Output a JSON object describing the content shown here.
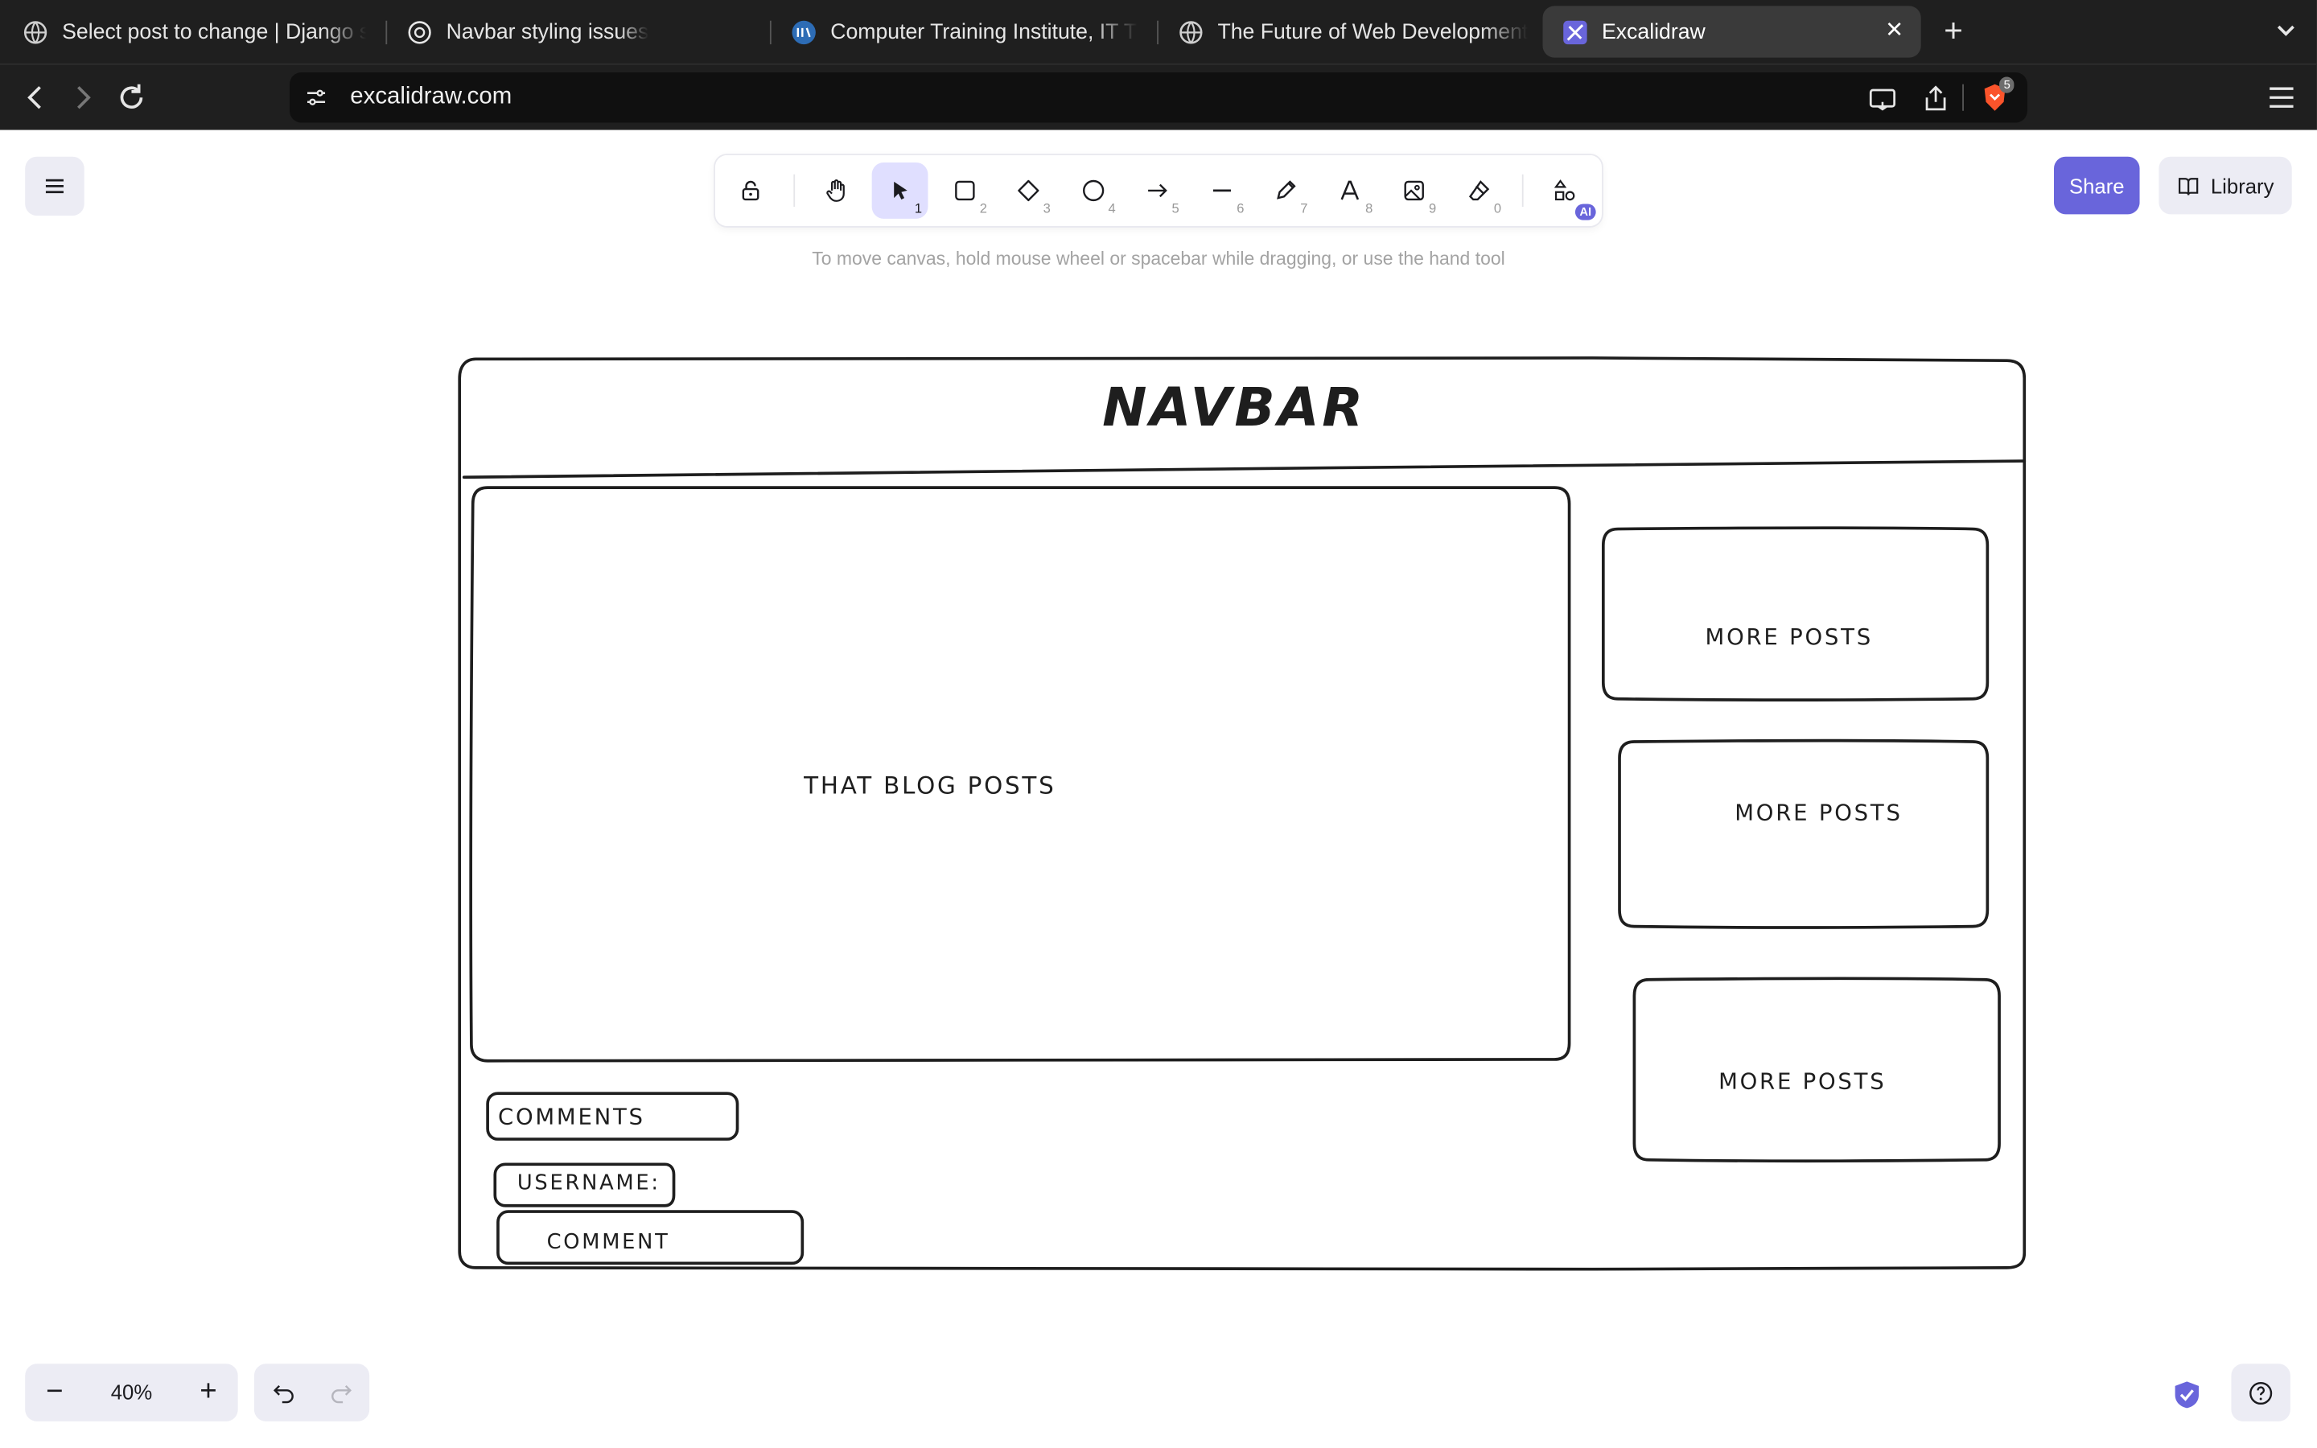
{
  "browser": {
    "tabs": [
      {
        "label": "Select post to change | Django site admin",
        "active": false
      },
      {
        "label": "Navbar styling issues",
        "active": false
      },
      {
        "label": "Computer Training Institute, IT Training",
        "active": false
      },
      {
        "label": "The Future of Web Development",
        "active": false
      },
      {
        "label": "Excalidraw",
        "active": true
      }
    ],
    "url": "excalidraw.com",
    "brave_badge": "5"
  },
  "toolbar": {
    "tools": [
      {
        "name": "lock",
        "num": ""
      },
      {
        "name": "hand",
        "num": ""
      },
      {
        "name": "selection",
        "num": "1"
      },
      {
        "name": "rectangle",
        "num": "2"
      },
      {
        "name": "diamond",
        "num": "3"
      },
      {
        "name": "ellipse",
        "num": "4"
      },
      {
        "name": "arrow",
        "num": "5"
      },
      {
        "name": "line",
        "num": "6"
      },
      {
        "name": "draw",
        "num": "7"
      },
      {
        "name": "text",
        "num": "8"
      },
      {
        "name": "image",
        "num": "9"
      },
      {
        "name": "eraser",
        "num": "0"
      }
    ],
    "ai_badge": "AI",
    "hint": "To move canvas, hold mouse wheel or spacebar while dragging, or use the hand tool"
  },
  "header": {
    "share_label": "Share",
    "library_label": "Library"
  },
  "canvas": {
    "navbar": "NAVBAR",
    "blog": "THAT BLOG POSTS",
    "more_posts": [
      "MORE POSTS",
      "MORE POSTS",
      "MORE POSTS"
    ],
    "comments": "COMMENTS",
    "username": "USERNAME:",
    "comment": "COMMENT"
  },
  "footer": {
    "zoom": "40%",
    "zoom_out": "−",
    "zoom_in": "+"
  },
  "colors": {
    "accent": "#6965db",
    "accent_light": "#e0dfff",
    "panel": "#ececf4",
    "stroke": "#1e1e1e"
  }
}
